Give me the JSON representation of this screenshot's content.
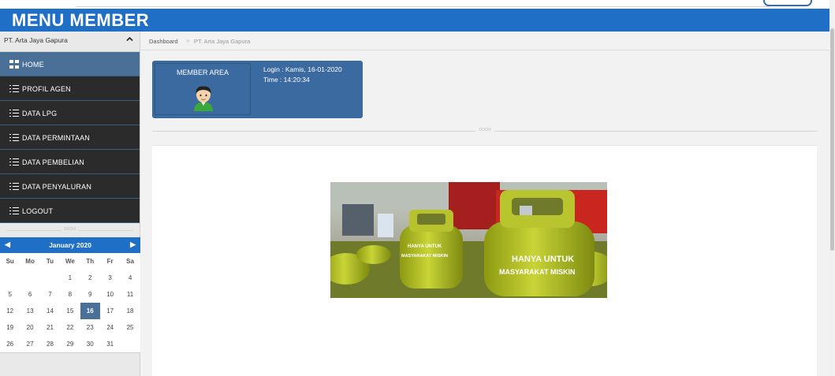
{
  "header": {
    "title": "MENU MEMBER"
  },
  "sidebar": {
    "company": "PT. Arta Jaya Gapura",
    "items": [
      {
        "label": "HOME",
        "icon": "grid-icon",
        "active": true
      },
      {
        "label": "PROFIL AGEN",
        "icon": "list-icon",
        "active": false
      },
      {
        "label": "DATA LPG",
        "icon": "list-icon",
        "active": false
      },
      {
        "label": "DATA PERMINTAAN",
        "icon": "list-icon",
        "active": false
      },
      {
        "label": "DATA PEMBELIAN",
        "icon": "list-icon",
        "active": false
      },
      {
        "label": "DATA PENYALURAN",
        "icon": "list-icon",
        "active": false
      },
      {
        "label": "LOGOUT",
        "icon": "list-icon",
        "active": false
      }
    ],
    "divider": "oooo"
  },
  "calendar": {
    "month": "January 2020",
    "dow": [
      "Su",
      "Mo",
      "Tu",
      "We",
      "Th",
      "Fr",
      "Sa"
    ],
    "weeks": [
      [
        "",
        "",
        "",
        "1",
        "2",
        "3",
        "4"
      ],
      [
        "5",
        "6",
        "7",
        "8",
        "9",
        "10",
        "11"
      ],
      [
        "12",
        "13",
        "14",
        "15",
        "16",
        "17",
        "18"
      ],
      [
        "19",
        "20",
        "21",
        "22",
        "23",
        "24",
        "25"
      ],
      [
        "26",
        "27",
        "28",
        "29",
        "30",
        "31",
        ""
      ]
    ],
    "today": "16"
  },
  "breadcrumb": {
    "home": "Dashboard",
    "separator": "»",
    "current": "PT. Arta Jaya Gapura"
  },
  "member_card": {
    "area_label": "MEMBER AREA",
    "login": "Login : Kamis, 16-01-2020",
    "time": "Time : 14:20:34"
  },
  "main": {
    "divider": "oooo"
  },
  "banner": {
    "text_small": "HANYA UNTUK MASYARAKAT MISKIN",
    "text_large_1": "HANYA UNTUK",
    "text_large_2": "MASYARAKAT MISKIN"
  },
  "colors": {
    "primary": "#1f6fc6",
    "active": "#4a7098",
    "menu_bg": "#2b2b2b",
    "lpg_green": "#b5c22a"
  }
}
